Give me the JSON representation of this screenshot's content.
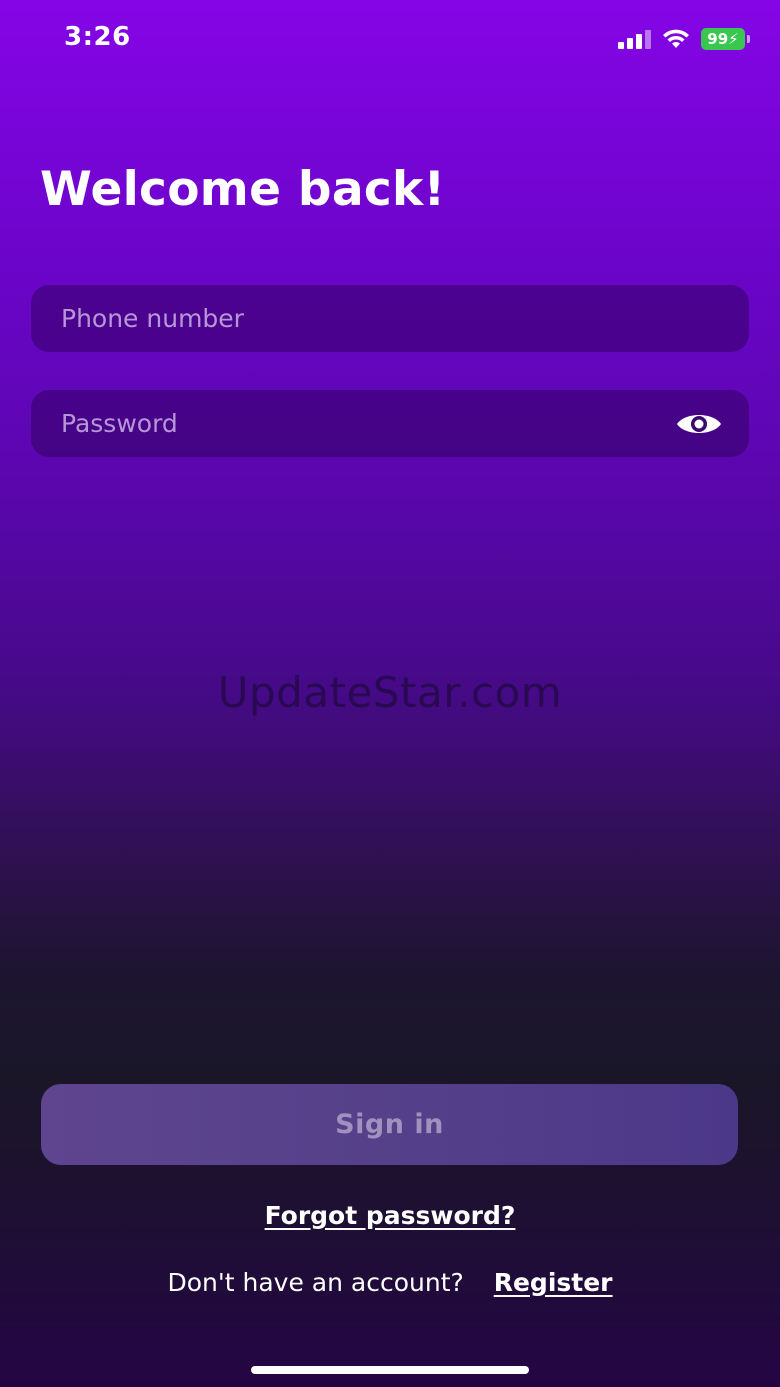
{
  "status_bar": {
    "time": "3:26",
    "battery_level": "99",
    "battery_color": "#39c74f",
    "signal_icon": "cellular-signal-icon",
    "wifi_icon": "wifi-icon",
    "battery_icon": "battery-charging-icon"
  },
  "page": {
    "title": "Welcome back!"
  },
  "form": {
    "phone_placeholder": "Phone number",
    "phone_value": "",
    "password_placeholder": "Password",
    "password_value": "",
    "eye_icon": "eye-icon"
  },
  "watermark": "UpdateStar.com",
  "actions": {
    "sign_in_label": "Sign in",
    "forgot_password_label": "Forgot password?",
    "no_account_text": "Don't have an account?",
    "register_label": "Register"
  },
  "colors": {
    "gradient_top": "#8505e6",
    "gradient_mid": "#1a1628",
    "button": "#55408a",
    "text": "#ffffff"
  }
}
